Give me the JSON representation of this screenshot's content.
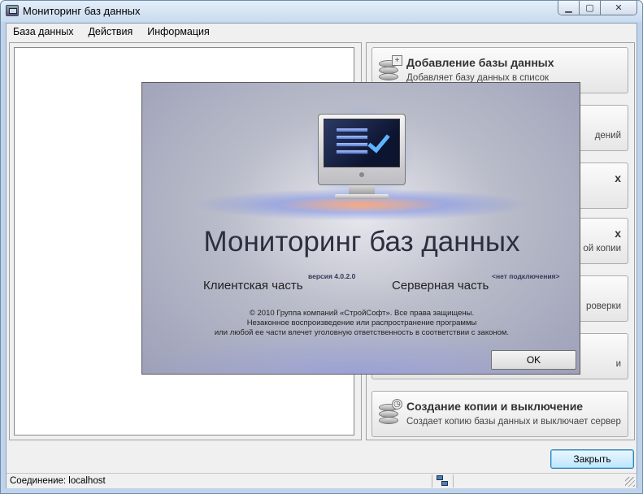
{
  "window": {
    "title": "Мониторинг баз данных",
    "minimize_glyph": "▁",
    "maximize_glyph": "▢",
    "close_glyph": "✕"
  },
  "menu": [
    "База данных",
    "Действия",
    "Информация"
  ],
  "commands": [
    {
      "title": "Добавление базы данных",
      "desc": "Добавляет базу данных в список"
    },
    {
      "visible_desc": "дений"
    },
    {
      "visible_title": "х"
    },
    {
      "visible_title": "х",
      "visible_desc": "ой копии"
    },
    {
      "visible_desc": "роверки"
    },
    {
      "visible_desc": "и"
    },
    {
      "title": "Создание копии и выключение",
      "desc": "Создает копию базы данных и выключает сервер"
    }
  ],
  "close_button": "Закрыть",
  "status": {
    "connection": "Соединение: localhost"
  },
  "splash": {
    "title": "Мониторинг баз данных",
    "version": "версия 4.0.2.0",
    "connection_status": "<нет подключения>",
    "client_part": "Клиентская часть",
    "server_part": "Серверная часть",
    "legal": [
      "© 2010 Группа компаний «СтройСофт». Все права защищены.",
      "Незаконное воспроизведение или распространение программы",
      "или любой ее части влечет уголовную ответственность в соответствии с законом."
    ],
    "ok": "OK"
  },
  "colors": {
    "accent_blue": "#3c7fb1",
    "check_blue": "#5fb4ff"
  },
  "icons": [
    "app-icon",
    "database-add-icon",
    "database-clock-icon",
    "network-icon",
    "monitor-check-icon"
  ]
}
